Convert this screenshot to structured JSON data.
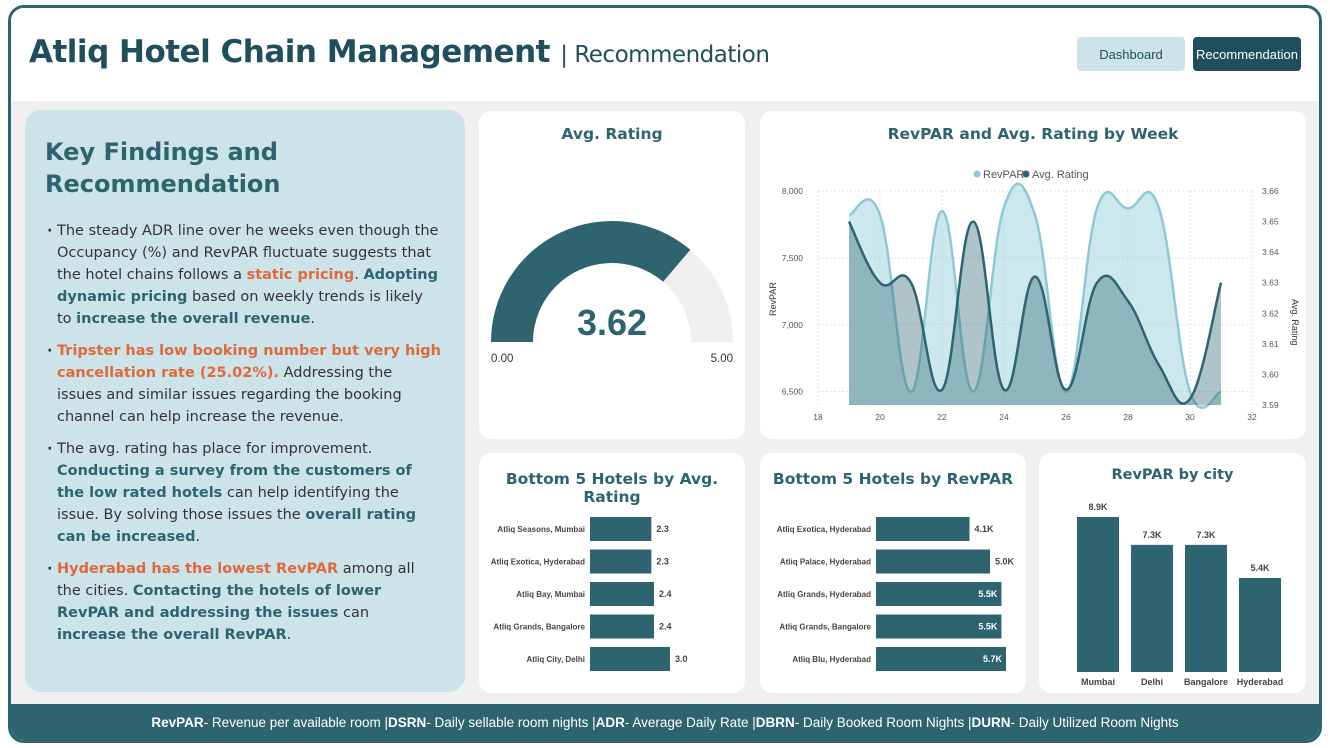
{
  "header": {
    "title": "Atliq Hotel Chain Management",
    "subtitle": "| Recommendation",
    "nav_dashboard": "Dashboard",
    "nav_recommendation": "Recommendation"
  },
  "findings": {
    "title_line1": "Key Findings and",
    "title_line2": "Recommendation",
    "f1": {
      "t1": "The steady ADR line over he weeks even though the Occupancy (%) and RevPAR fluctuate suggests that the hotel chains follows a ",
      "h1": "static pricing",
      "t2": ". ",
      "h2": "Adopting dynamic pricing",
      "t3": " based on weekly trends is likely to ",
      "h3": "increase the overall revenue",
      "t4": "."
    },
    "f2": {
      "h1": "Tripster has low booking number but very high cancellation rate (25.02%).",
      "t1": " Addressing the issues and similar issues regarding the booking channel can help increase the revenue."
    },
    "f3": {
      "t1": "The avg. rating has place for improvement. ",
      "h1": "Conducting a survey from the customers of the low rated hotels",
      "t2": " can help identifying the issue. By solving those issues the ",
      "h2": "overall rating can be increased",
      "t3": "."
    },
    "f4": {
      "h1": "Hyderabad has the lowest RevPAR",
      "t1": " among all the cities. ",
      "h2": "Contacting the hotels of lower RevPAR and addressing the issues",
      "t2": " can ",
      "h3": "increase the overall RevPAR",
      "t3": "."
    }
  },
  "gauge": {
    "title": "Avg. Rating",
    "value": 3.62,
    "value_label": "3.62",
    "min_label": "0.00",
    "max_label": "5.00",
    "min": 0,
    "max": 5
  },
  "colors": {
    "primary": "#2d6470",
    "light": "#8fc9d6",
    "accent": "#e0693a",
    "panel_bg": "#cde3ea"
  },
  "chart_data": [
    {
      "type": "area",
      "title": "RevPAR and Avg. Rating by Week",
      "legend": [
        "RevPAR",
        "Avg. Rating"
      ],
      "legend_position": "top-center",
      "ylabel": "RevPAR",
      "y2label": "Avg. Rating",
      "xlim": [
        18,
        32
      ],
      "ylim": [
        6400,
        8000
      ],
      "y2lim": [
        3.59,
        3.66
      ],
      "x_ticks": [
        "18",
        "20",
        "22",
        "24",
        "26",
        "28",
        "30",
        "32"
      ],
      "y_ticks": [
        "8,000",
        "7,500",
        "7,000",
        "6,500"
      ],
      "y2_ticks": [
        "3.66",
        "3.65",
        "3.64",
        "3.63",
        "3.62",
        "3.61",
        "3.60",
        "3.59"
      ],
      "x": [
        19,
        20,
        21,
        22,
        23,
        24,
        25,
        26,
        27,
        28,
        29,
        30,
        31
      ],
      "series": [
        {
          "name": "RevPAR",
          "values": [
            7820,
            7820,
            6500,
            7850,
            6500,
            7880,
            7820,
            6500,
            7870,
            7870,
            7870,
            6500,
            6500
          ]
        },
        {
          "name": "Avg. Rating",
          "values": [
            3.65,
            3.63,
            3.63,
            3.595,
            3.65,
            3.595,
            3.632,
            3.595,
            3.63,
            3.624,
            3.603,
            3.592,
            3.63
          ]
        }
      ]
    },
    {
      "type": "bar",
      "title": "Bottom 5 Hotels by Avg. Rating",
      "orientation": "horizontal",
      "categories": [
        "Atliq Seasons, Mumbai",
        "Atliq Exotica, Hyderabad",
        "Atliq Bay, Mumbai",
        "Atliq Grands, Bangalore",
        "Atliq City, Delhi"
      ],
      "values": [
        2.3,
        2.3,
        2.4,
        2.4,
        3.0
      ],
      "labels": [
        "2.3",
        "2.3",
        "2.4",
        "2.4",
        "3.0"
      ]
    },
    {
      "type": "bar",
      "title": "Bottom 5 Hotels by RevPAR",
      "orientation": "horizontal",
      "categories": [
        "Atliq Exotica, Hyderabad",
        "Atliq Palace, Hyderabad",
        "Atliq Grands, Hyderabad",
        "Atliq Grands, Bangalore",
        "Atliq Blu, Hyderabad"
      ],
      "values": [
        4.1,
        5.0,
        5.5,
        5.5,
        5.7
      ],
      "labels": [
        "4.1K",
        "5.0K",
        "5.5K",
        "5.5K",
        "5.7K"
      ]
    },
    {
      "type": "bar",
      "title": "RevPAR by city",
      "orientation": "vertical",
      "categories": [
        "Mumbai",
        "Delhi",
        "Bangalore",
        "Hyderabad"
      ],
      "values": [
        8.9,
        7.3,
        7.3,
        5.4
      ],
      "labels": [
        "8.9K",
        "7.3K",
        "7.3K",
        "5.4K"
      ]
    }
  ],
  "footer": {
    "t1": "RevPAR",
    "d1": " - Revenue per available room | ",
    "t2": "DSRN",
    "d2": " - Daily sellable room nights | ",
    "t3": "ADR",
    "d3": " - Average Daily Rate | ",
    "t4": "DBRN",
    "d4": " - Daily Booked Room Nights | ",
    "t5": "DURN",
    "d5": " - Daily Utilized Room Nights"
  }
}
